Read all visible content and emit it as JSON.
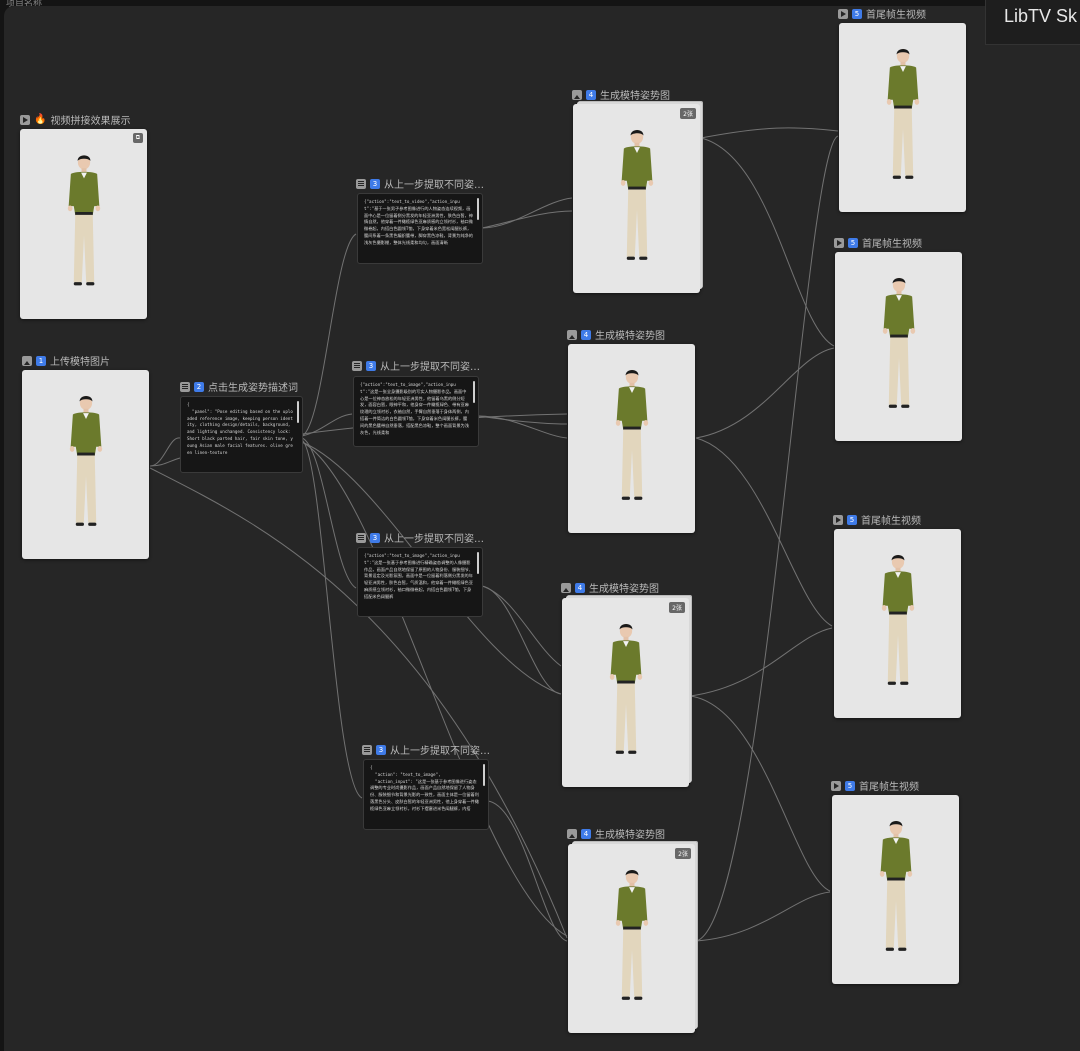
{
  "window": {
    "top_label": "项目名称",
    "side_panel_title": "LibTV Sk"
  },
  "colors": {
    "canvas_bg": "#262626",
    "node_badge": "#3f7be8",
    "wire": "#8c8c8c"
  },
  "nodes": {
    "video_showcase": {
      "icon": "play-icon",
      "emoji": "🔥",
      "title": "视频拼接效果展示"
    },
    "upload": {
      "icon": "image-icon",
      "num": "1",
      "title": "上传模特图片"
    },
    "describe": {
      "icon": "doc-icon",
      "num": "2",
      "title": "点击生成姿势描述词",
      "text": "{\n  \"panel\": \"Pose editing based on the uploaded reference image, keeping person identity, clothing design/details, background, and lighting unchanged. Consistency lock: Short black parted hair, fair skin tone, young Asian male facial features. olive green linen-texture"
    },
    "extract_1": {
      "icon": "doc-icon",
      "num": "3",
      "title": "从上一步提取不同姿…",
      "text": "{\"action\":\"text_to_video\",\"action_input\":\"基于一张男子参考图像进行的人物姿态连续视频，画面中心是一位留着侧分黑发的年轻亚洲男性，肤色白皙，神情自然，他穿着一件橄榄绿色亚麻质感的立领衬衫，袖口微微卷起，内搭白色圆领T恤，下身穿着米色宽松阔腿长裤，腰间系着一条黑色编织腰带，脚穿黑色凉鞋，背景为纯净的浅灰色摄影棚，整体光线柔和均匀，画面清晰"
    },
    "extract_2": {
      "icon": "doc-icon",
      "num": "3",
      "title": "从上一步提取不同姿…",
      "text": "{\"action\":\"text_to_image\",\"action_input\":\"这是一张全身摄影级别的写实人物摄影作品，画面中心是一位神态放松的年轻亚洲男性，他留着乌黑的侧分短发，面容白皙，眼神平和，他身穿一件橄榄绿色、带有亚麻纹理的立领衬衫，衣袖自然，手臂自然垂落于身体两侧，内搭着一件简洁的白色圆领T恤，下身穿着米色阔腿长裤，腰间的黑色腰带自然垂落，搭配黑色凉鞋，整个画面背景为浅灰色，光线柔和"
    },
    "extract_3": {
      "icon": "doc-icon",
      "num": "3",
      "title": "从上一步提取不同姿…",
      "text": "{\"action\":\"text_to_image\",\"action_input\":\"这是一张基于参考图像进行精确姿态调整的人像摄影作品，画面产品自然地保留了原图的人物身份、服装细节、背景设定及光影氛围，画面中是一位留着利落侧分黑发的年轻亚洲男性，肤色白皙，气质温和，他穿着一件橄榄绿色亚麻质感立领衬衫，袖口微微卷起，内搭白色圆领T恤，下身搭配米色阔腿裤"
    },
    "extract_4": {
      "icon": "doc-icon",
      "num": "3",
      "title": "从上一步提取不同姿…",
      "text": "{\n  \"action\": \"text_to_image\",\n  \"action_input\": \"这是一张基于参考图像进行姿态调整的专业时尚摄影作品，画面产品自然地保留了人物身份、服装细节和背景光影的一致性，画面主体是一位留着利落黑色分头、皮肤白皙的年轻亚洲男性，他上身穿着一件橄榄绿色亚麻立领衬衫，衬衫下摆塞进米色阔腿裤，内搭"
    },
    "pose_1": {
      "icon": "image-icon",
      "num": "4",
      "title": "生成模特姿势图",
      "badge": "2张"
    },
    "pose_2": {
      "icon": "image-icon",
      "num": "4",
      "title": "生成模特姿势图"
    },
    "pose_3": {
      "icon": "image-icon",
      "num": "4",
      "title": "生成模特姿势图",
      "badge": "2张"
    },
    "pose_4": {
      "icon": "image-icon",
      "num": "4",
      "title": "生成模特姿势图",
      "badge": "2张"
    },
    "video_1": {
      "icon": "play-icon",
      "num": "5",
      "title": "首尾帧生视频"
    },
    "video_2": {
      "icon": "play-icon",
      "num": "5",
      "title": "首尾帧生视频"
    },
    "video_3": {
      "icon": "play-icon",
      "num": "5",
      "title": "首尾帧生视频"
    },
    "video_4": {
      "icon": "play-icon",
      "num": "5",
      "title": "首尾帧生视频"
    }
  }
}
